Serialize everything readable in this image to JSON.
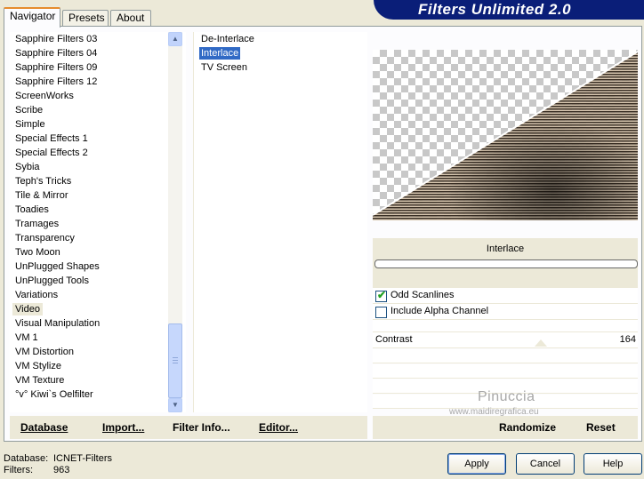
{
  "tabs": [
    {
      "label": "Navigator",
      "active": true
    },
    {
      "label": "Presets",
      "active": false
    },
    {
      "label": "About",
      "active": false
    }
  ],
  "title": "Filters Unlimited 2.0",
  "categories": [
    "Sapphire Filters 03",
    "Sapphire Filters 04",
    "Sapphire Filters 09",
    "Sapphire Filters 12",
    "ScreenWorks",
    "Scribe",
    "Simple",
    "Special Effects 1",
    "Special Effects 2",
    "Sybia",
    "Teph's Tricks",
    "Tile & Mirror",
    "Toadies",
    "Tramages",
    "Transparency",
    "Two Moon",
    "UnPlugged Shapes",
    "UnPlugged Tools",
    "Variations",
    "Video",
    "Visual Manipulation",
    "VM 1",
    "VM Distortion",
    "VM Stylize",
    "VM Texture",
    "°v° Kiwi`s Oelfilter"
  ],
  "selected_category": "Video",
  "filters": [
    "De-Interlace",
    "Interlace",
    "TV Screen"
  ],
  "selected_filter": "Interlace",
  "left_buttons": {
    "database": "Database",
    "import": "Import...",
    "filter_info": "Filter Info...",
    "editor": "Editor..."
  },
  "filter_panel": {
    "name": "Interlace",
    "options": [
      {
        "label": "Odd Scanlines",
        "checked": true
      },
      {
        "label": "Include Alpha Channel",
        "checked": false
      }
    ],
    "slider": {
      "label": "Contrast",
      "value": "164",
      "value_fraction": 0.64
    }
  },
  "watermark": {
    "title": "Pinuccia",
    "url": "www.maidiregrafica.eu"
  },
  "right_buttons": {
    "randomize": "Randomize",
    "reset": "Reset"
  },
  "status": {
    "database_label": "Database:",
    "database_value": "ICNET-Filters",
    "filters_label": "Filters:",
    "filters_value": "963"
  },
  "dialog_buttons": {
    "apply": "Apply",
    "cancel": "Cancel",
    "help": "Help"
  },
  "colors": {
    "banner": "#0a1e78",
    "selection": "#316ac5",
    "panel": "#ece9d8"
  }
}
